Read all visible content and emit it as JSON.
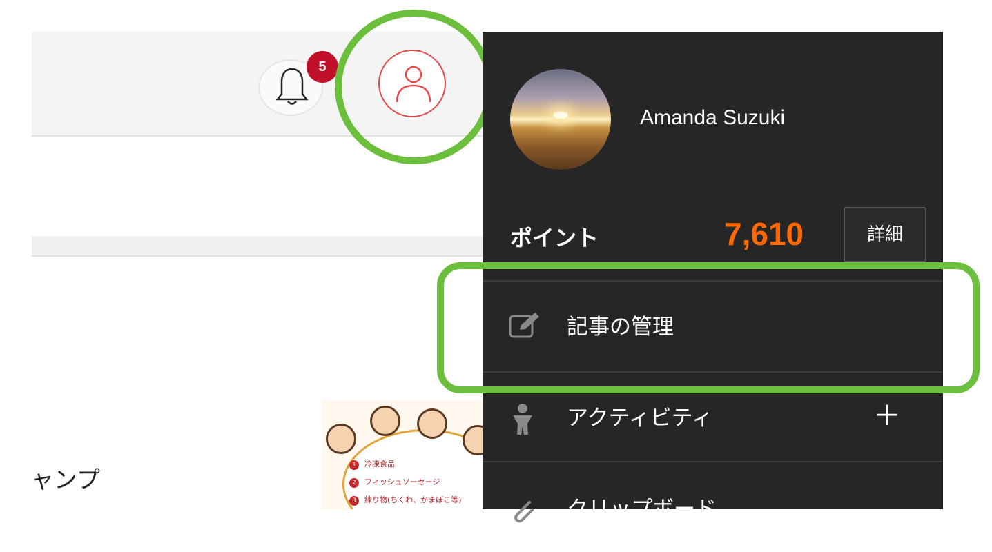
{
  "header": {
    "notification_count": "5",
    "bell_icon": "bell-icon",
    "user_icon": "user-icon"
  },
  "background": {
    "partial_text": "ャンプ",
    "thumbnail": {
      "items": [
        {
          "num": "1",
          "text": "冷凍食品"
        },
        {
          "num": "2",
          "text": "フィッシュソーセージ"
        },
        {
          "num": "3",
          "text": "練り物(ちくわ、かまぼこ等)"
        }
      ]
    }
  },
  "menu": {
    "user_name": "Amanda Suzuki",
    "points_label": "ポイント",
    "points_value": "7,610",
    "detail_button": "詳細",
    "items": [
      {
        "label": "記事の管理",
        "icon": "edit-icon"
      },
      {
        "label": "アクティビティ",
        "icon": "person-icon",
        "expand": "＋"
      },
      {
        "label": "クリップボード",
        "icon": "paperclip-icon"
      }
    ]
  },
  "colors": {
    "accent_green": "#6bbf3c",
    "points_orange": "#ff6a00",
    "badge_red": "#c0102a",
    "user_icon_red": "#e44a4a",
    "panel_bg": "#262626"
  }
}
